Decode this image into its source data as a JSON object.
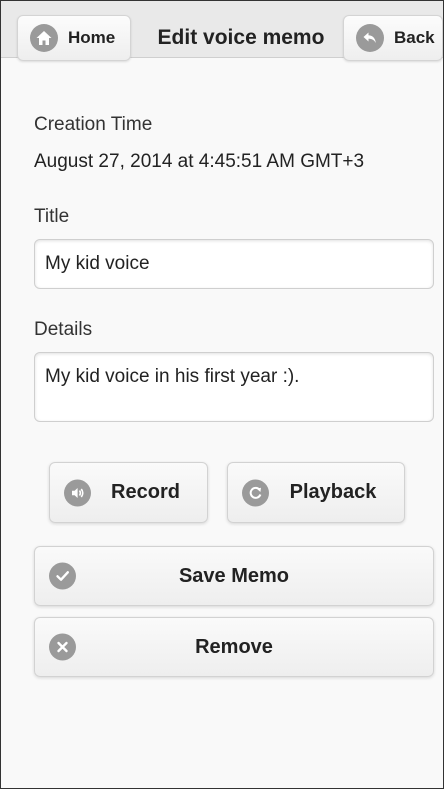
{
  "header": {
    "home_label": "Home",
    "title": "Edit voice memo",
    "back_label": "Back"
  },
  "creation": {
    "label": "Creation Time",
    "value": "August 27, 2014 at 4:45:51 AM GMT+3"
  },
  "title_field": {
    "label": "Title",
    "value": "My kid voice"
  },
  "details_field": {
    "label": "Details",
    "value": "My kid voice in his first year :)."
  },
  "buttons": {
    "record": "Record",
    "playback": "Playback",
    "save": "Save Memo",
    "remove": "Remove"
  },
  "icons": {
    "home": "home-icon",
    "back": "back-arrow-icon",
    "record": "speaker-icon",
    "playback": "refresh-icon",
    "save": "check-icon",
    "remove": "close-icon"
  },
  "colors": {
    "icon_circle": "#9a9a9a",
    "header_bg": "#e9e9e9",
    "page_bg": "#f9f9f9"
  }
}
